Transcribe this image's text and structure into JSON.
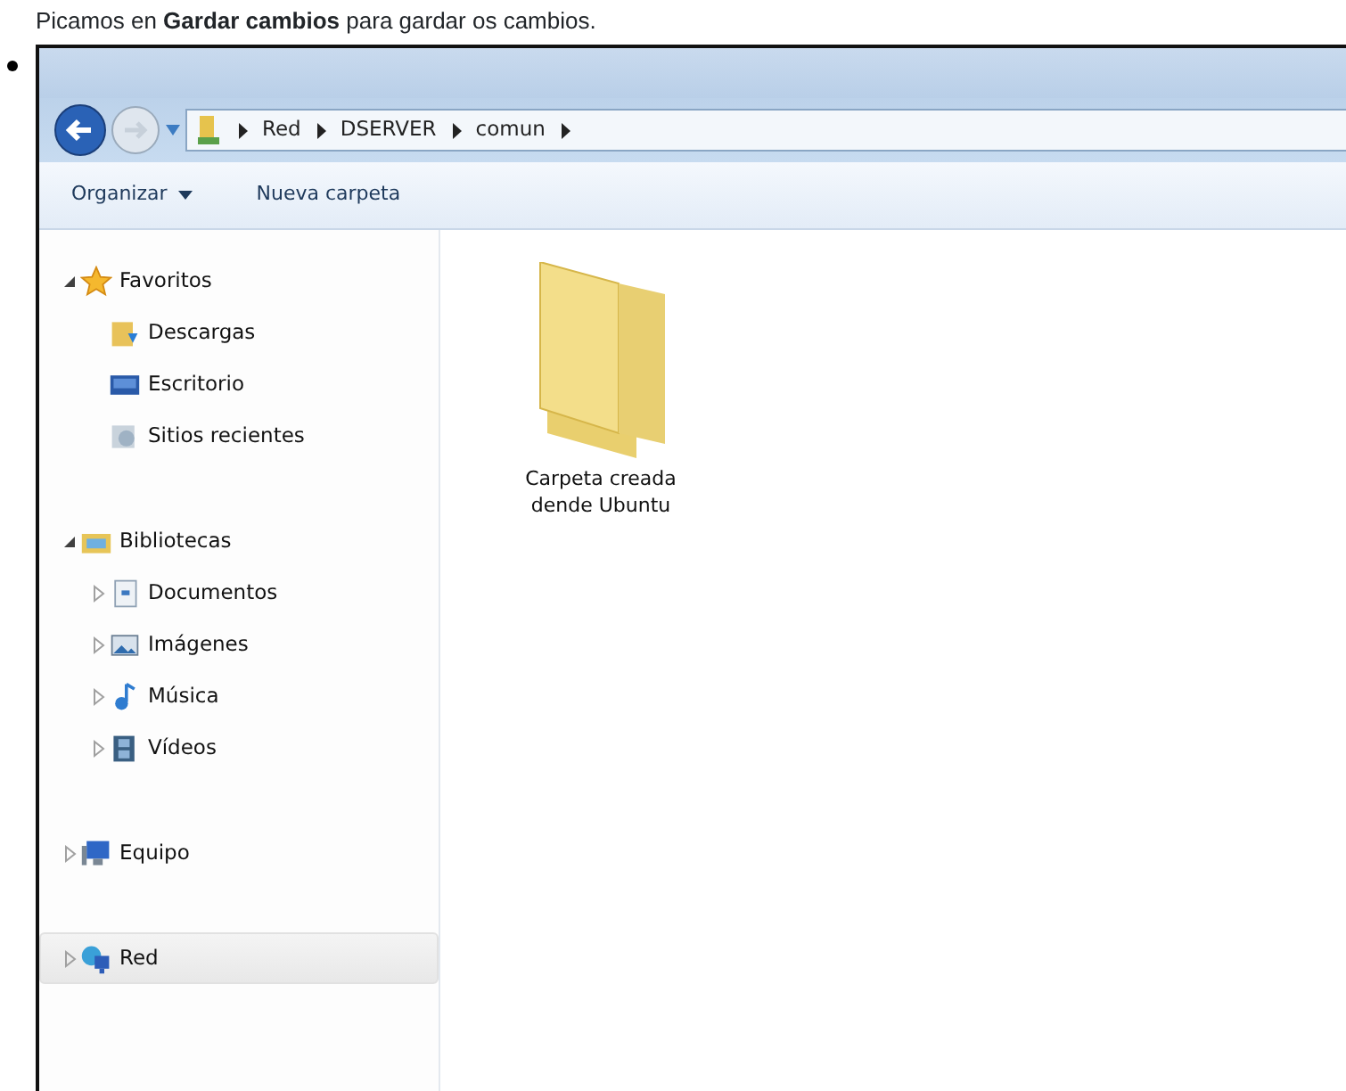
{
  "caption": "Picamos en **Gardar cambios** para gardar os cambios.",
  "explorer": {
    "breadcrumb": [
      "Red",
      "DSERVER",
      "comun"
    ],
    "toolbar": [
      {
        "label": "Organizar",
        "dropdown": true
      },
      {
        "label": "Nueva carpeta",
        "dropdown": false
      }
    ],
    "nav_tree": [
      {
        "label": "Favoritos",
        "expanded": true,
        "selected": false,
        "children": [
          {
            "label": "Descargas",
            "selected": false
          },
          {
            "label": "Escritorio",
            "selected": false
          },
          {
            "label": "Sitios recientes",
            "selected": false
          }
        ]
      },
      {
        "label": "Bibliotecas",
        "expanded": true,
        "selected": false,
        "children": [
          {
            "label": "Documentos",
            "expanded": false,
            "selected": false
          },
          {
            "label": "Imágenes",
            "expanded": false,
            "selected": false
          },
          {
            "label": "Música",
            "expanded": false,
            "selected": false
          },
          {
            "label": "Vídeos",
            "expanded": false,
            "selected": false
          }
        ]
      },
      {
        "label": "Equipo",
        "expanded": false,
        "selected": false
      },
      {
        "label": "Red",
        "expanded": false,
        "selected": true
      }
    ],
    "items": [
      {
        "label": "Carpeta creada dende Ubuntu"
      }
    ]
  }
}
